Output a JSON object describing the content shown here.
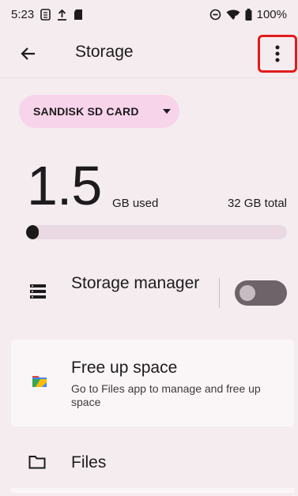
{
  "status_bar": {
    "time": "5:23",
    "battery": "100%",
    "icons": [
      "sim-card-icon",
      "upload-icon",
      "sd-card-icon",
      "do-not-disturb-icon",
      "wifi-icon",
      "battery-icon"
    ]
  },
  "app_bar": {
    "title": "Storage",
    "back_icon": "arrow-back-icon",
    "more_icon": "more-vert-icon"
  },
  "volume_chip": {
    "label": "SANDISK SD CARD",
    "icon": "dropdown-arrow-icon"
  },
  "usage": {
    "used_value": "1.5",
    "used_unit": "GB used",
    "total": "32 GB total",
    "fraction_used": 0.047
  },
  "storage_manager": {
    "label": "Storage manager",
    "enabled": false,
    "icon": "storage-list-icon"
  },
  "free_up_card": {
    "title": "Free up space",
    "subtitle": "Go to Files app to manage and free up space",
    "icon": "files-app-icon"
  },
  "files_row": {
    "label": "Files",
    "icon": "folder-icon"
  },
  "colors": {
    "background": "#f4ecef",
    "chip": "#f8d4eb",
    "highlight_border": "#e21b1b"
  }
}
